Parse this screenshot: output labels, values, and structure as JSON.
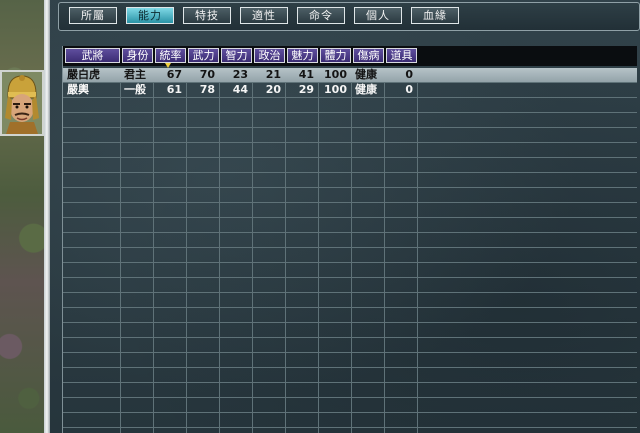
{
  "tabs": [
    {
      "label": "所屬",
      "active": false
    },
    {
      "label": "能力",
      "active": true
    },
    {
      "label": "特技",
      "active": false
    },
    {
      "label": "適性",
      "active": false
    },
    {
      "label": "命令",
      "active": false
    },
    {
      "label": "個人",
      "active": false
    },
    {
      "label": "血緣",
      "active": false
    }
  ],
  "table": {
    "headers": [
      "武將",
      "身份",
      "統率",
      "武力",
      "智力",
      "政治",
      "魅力",
      "體力",
      "傷病",
      "道具"
    ],
    "sorted_column": "統率",
    "rows": [
      {
        "name": "嚴白虎",
        "status": "君主",
        "lead": "67",
        "war": "70",
        "int": "23",
        "pol": "21",
        "chr": "41",
        "hp": "100",
        "health": "健康",
        "items": "0",
        "selected": true
      },
      {
        "name": "嚴輿",
        "status": "一般",
        "lead": "61",
        "war": "78",
        "int": "44",
        "pol": "20",
        "chr": "29",
        "hp": "100",
        "health": "健康",
        "items": "0",
        "selected": false
      }
    ]
  },
  "colors": {
    "header_purple": "#4b3b8a",
    "active_tab_cyan": "#3fb3c6",
    "selected_row": "#a8b6bb",
    "panel_bg": "#2b3a40"
  },
  "icons": {
    "portrait": "general-portrait",
    "sort": "sort-down-icon"
  }
}
